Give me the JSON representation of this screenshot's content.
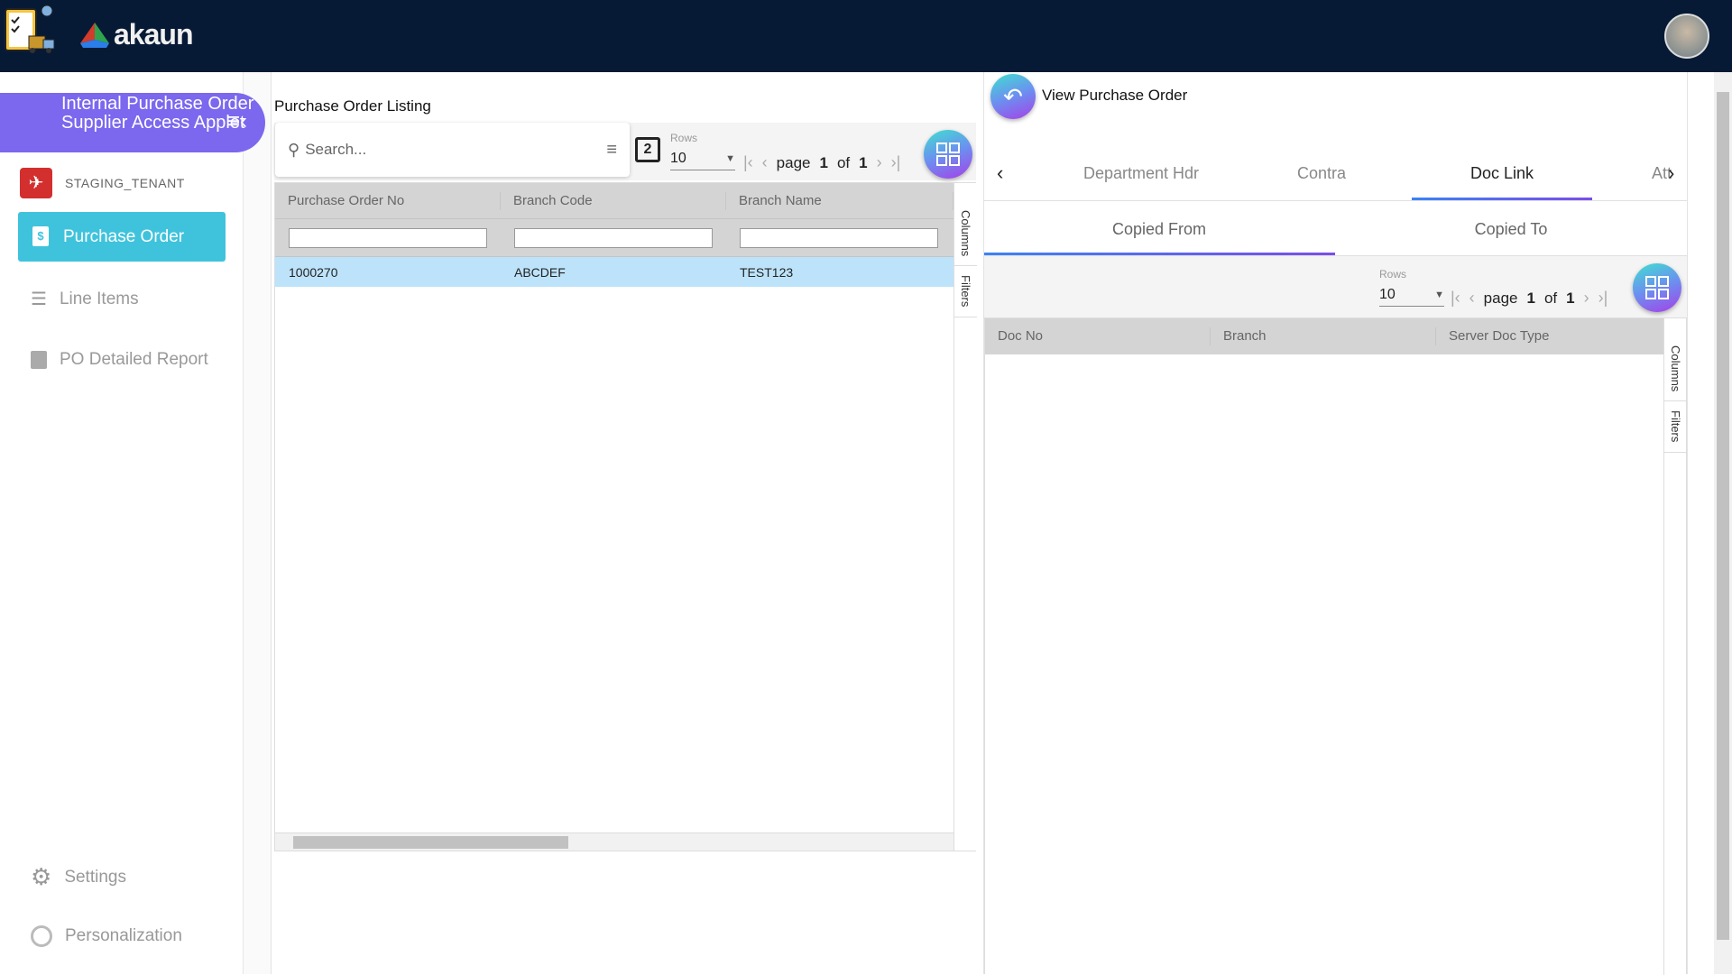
{
  "header": {
    "logo_text": "akaun"
  },
  "sidebar": {
    "applet_title": "Internal Purchase Order Supplier Access Applet",
    "tenant": "STAGING_TENANT",
    "items": [
      {
        "label": "Purchase Order"
      },
      {
        "label": "Line Items"
      },
      {
        "label": "PO Detailed Report"
      }
    ],
    "settings": "Settings",
    "personalization": "Personalization"
  },
  "listing": {
    "title": "Purchase Order Listing",
    "search_placeholder": "Search...",
    "rows_label": "Rows",
    "rows_value": "10",
    "page_word": "page",
    "page": "1",
    "of_word": "of",
    "total_pages": "1",
    "columns": [
      "Purchase Order No",
      "Branch Code",
      "Branch Name"
    ],
    "rows": [
      [
        "1000270",
        "ABCDEF",
        "TEST123"
      ]
    ],
    "side_tabs": [
      "Columns",
      "Filters"
    ]
  },
  "view": {
    "title": "View Purchase Order",
    "tabs": [
      "Department Hdr",
      "Contra",
      "Doc Link",
      "Att"
    ],
    "active_tab": "Doc Link",
    "subtabs": [
      "Copied From",
      "Copied To"
    ],
    "rows_label": "Rows",
    "rows_value": "10",
    "page_word": "page",
    "page": "1",
    "of_word": "of",
    "total_pages": "1",
    "columns": [
      "Doc No",
      "Branch",
      "Server Doc Type"
    ],
    "side_tabs": [
      "Columns",
      "Filters"
    ]
  },
  "colors": {
    "header": "#061a35",
    "applet": "#7b68ee",
    "active_nav": "#3fc3dc",
    "selected_row": "#bde3fb"
  }
}
